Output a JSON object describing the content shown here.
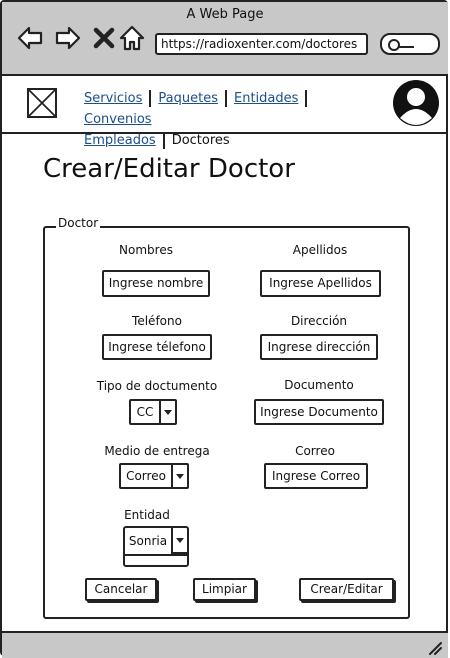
{
  "browser": {
    "window_title": "A Web Page",
    "url": "https://radioxenter.com/doctores"
  },
  "nav": {
    "links": [
      "Servicios",
      "Paquetes",
      "Entidades",
      "Convenios",
      "Empleados"
    ],
    "current": "Doctores"
  },
  "page": {
    "title": "Crear/Editar Doctor"
  },
  "form": {
    "legend": "Doctor",
    "nombres": {
      "label": "Nombres",
      "value": "Ingrese nombre"
    },
    "apellidos": {
      "label": "Apellidos",
      "value": "Ingrese Apellidos"
    },
    "telefono": {
      "label": "Teléfono",
      "value": "Ingrese télefono"
    },
    "direccion": {
      "label": "Dirección",
      "value": "Ingrese dirección"
    },
    "tipo_documento": {
      "label": "Tipo de doctumento",
      "selected": "CC"
    },
    "documento": {
      "label": "Documento",
      "value": "Ingrese Documento"
    },
    "medio_entrega": {
      "label": "Medio de entrega",
      "selected": "Correo"
    },
    "correo": {
      "label": "Correo",
      "value": "Ingrese Correo"
    },
    "entidad": {
      "label": "Entidad",
      "selected": "Sonria"
    }
  },
  "actions": {
    "cancel": "Cancelar",
    "clear": "Limpiar",
    "submit": "Crear/Editar"
  },
  "icons": [
    "back-arrow-icon",
    "forward-arrow-icon",
    "close-icon",
    "home-icon",
    "search-icon",
    "image-placeholder-icon",
    "user-avatar-icon",
    "resize-grip-icon"
  ]
}
